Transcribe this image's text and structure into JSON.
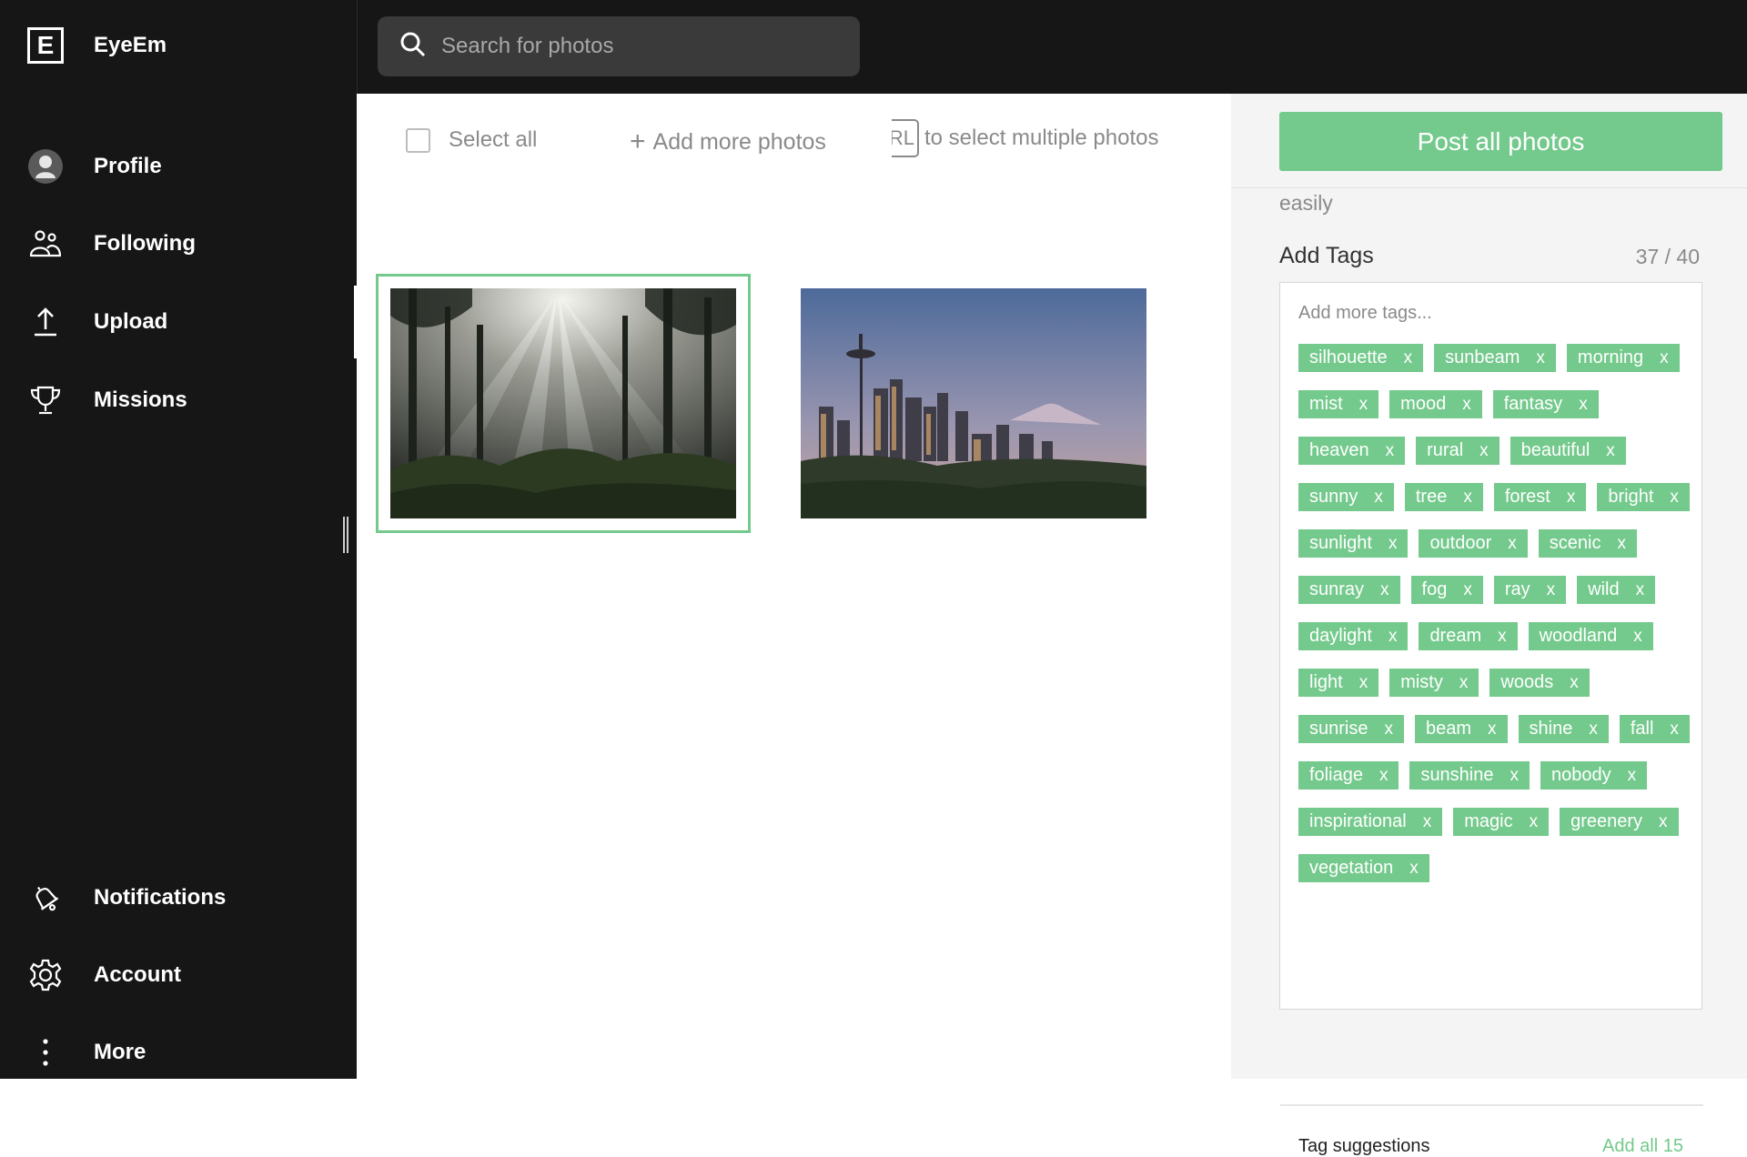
{
  "app": {
    "brand_letter": "E",
    "name": "EyeEm"
  },
  "sidebar": {
    "items": [
      {
        "label": "Profile",
        "icon": "avatar-icon"
      },
      {
        "label": "Following",
        "icon": "people-icon"
      },
      {
        "label": "Upload",
        "icon": "upload-icon"
      },
      {
        "label": "Missions",
        "icon": "trophy-icon"
      },
      {
        "label": "Notifications",
        "icon": "bell-icon"
      },
      {
        "label": "Account",
        "icon": "gear-icon"
      },
      {
        "label": "More",
        "icon": "more-vertical-icon"
      }
    ]
  },
  "search": {
    "placeholder": "Search for photos",
    "value": ""
  },
  "toolbar": {
    "select_all": "Select all",
    "add_more": "Add more photos",
    "ctrl_key": "RL",
    "multi_hint": "to select multiple photos"
  },
  "photos": [
    {
      "subject": "sunbeams through misty forest",
      "selected": true
    },
    {
      "subject": "Seattle skyline with Space Needle and Mount Rainier",
      "selected": false
    }
  ],
  "panel": {
    "post_button": "Post all photos",
    "description_tail": "easily",
    "tags_title": "Add Tags",
    "tags_count": "37 / 40",
    "tags_placeholder": "Add more tags...",
    "remove_symbol": "x",
    "tags": [
      "silhouette",
      "sunbeam",
      "morning",
      "mist",
      "mood",
      "fantasy",
      "heaven",
      "rural",
      "beautiful",
      "sunny",
      "tree",
      "forest",
      "bright",
      "sunlight",
      "outdoor",
      "scenic",
      "sunray",
      "fog",
      "ray",
      "wild",
      "daylight",
      "dream",
      "woodland",
      "light",
      "misty",
      "woods",
      "sunrise",
      "beam",
      "shine",
      "fall",
      "foliage",
      "sunshine",
      "nobody",
      "inspirational",
      "magic",
      "greenery",
      "vegetation"
    ],
    "suggestions_title": "Tag suggestions",
    "suggestions_add_all": "Add all 15"
  },
  "colors": {
    "accent": "#74c98c",
    "sidebar_bg": "#161616",
    "panel_bg": "#f4f4f4"
  }
}
